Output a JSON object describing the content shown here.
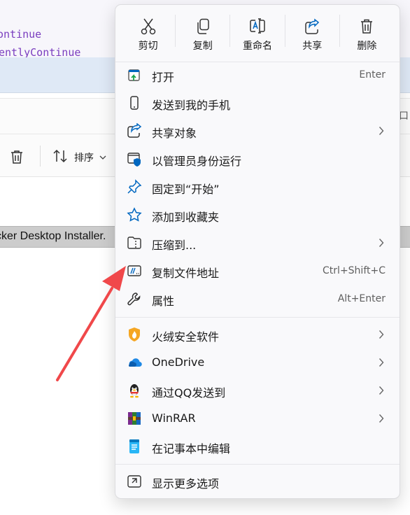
{
  "background": {
    "code_lines": [
      "ontinue",
      "entlyContinue"
    ],
    "address_tail": "口",
    "toolbar": {
      "sort_label": "排序"
    },
    "selected_file": "cker Desktop Installer."
  },
  "menu": {
    "top_actions": [
      {
        "label": "剪切",
        "icon": "scissors-icon"
      },
      {
        "label": "复制",
        "icon": "copy-icon"
      },
      {
        "label": "重命名",
        "icon": "rename-icon"
      },
      {
        "label": "共享",
        "icon": "share-icon"
      },
      {
        "label": "删除",
        "icon": "trash-icon"
      }
    ],
    "items": [
      {
        "label": "打开",
        "shortcut": "Enter",
        "icon": "open-icon"
      },
      {
        "label": "发送到我的手机",
        "icon": "phone-icon"
      },
      {
        "label": "共享对象",
        "icon": "share-icon",
        "submenu": true
      },
      {
        "label": "以管理员身份运行",
        "icon": "admin-shield-icon"
      },
      {
        "label": "固定到“开始”",
        "icon": "pin-icon"
      },
      {
        "label": "添加到收藏夹",
        "icon": "star-icon"
      },
      {
        "label": "压缩到...",
        "icon": "zip-folder-icon",
        "submenu": true
      },
      {
        "label": "复制文件地址",
        "shortcut": "Ctrl+Shift+C",
        "icon": "copy-path-icon"
      },
      {
        "label": "属性",
        "shortcut": "Alt+Enter",
        "icon": "wrench-icon"
      },
      {
        "label": "火绒安全软件",
        "icon": "huorong-icon",
        "submenu": true
      },
      {
        "label": "OneDrive",
        "icon": "onedrive-icon",
        "submenu": true
      },
      {
        "label": "通过QQ发送到",
        "icon": "qq-icon",
        "submenu": true
      },
      {
        "label": "WinRAR",
        "icon": "winrar-icon",
        "submenu": true
      },
      {
        "label": "在记事本中编辑",
        "icon": "notepad-icon"
      },
      {
        "label": "显示更多选项",
        "icon": "more-options-icon"
      }
    ]
  },
  "colors": {
    "accent": "#0067c0",
    "arrow": "#f0484a",
    "menu_bg": "#f9f9fb"
  }
}
